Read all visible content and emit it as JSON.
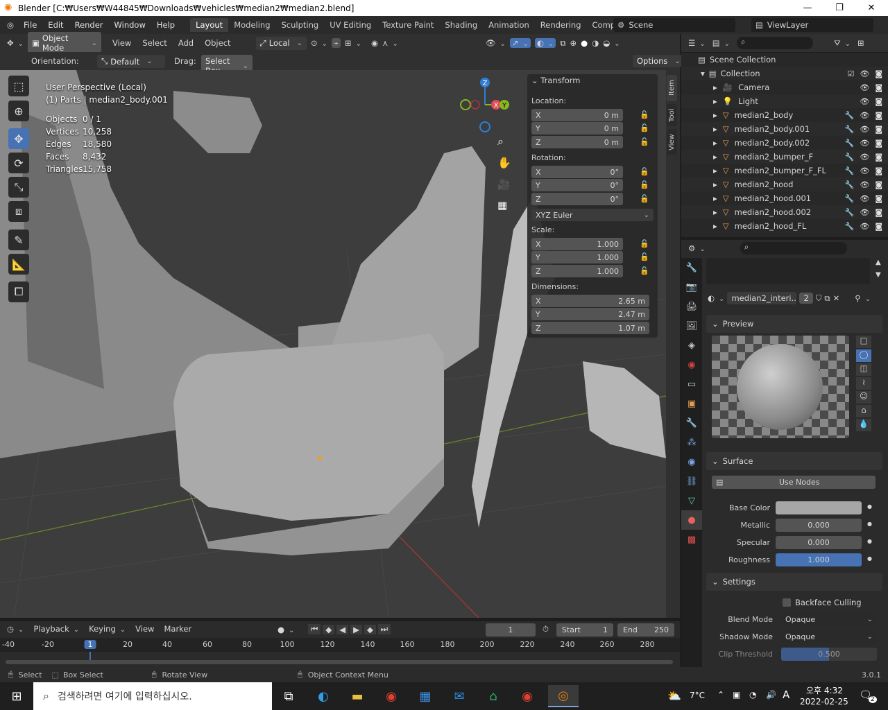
{
  "window": {
    "title": "Blender [C:₩Users₩W44845₩Downloads₩vehicles₩median2₩median2.blend]",
    "minimize": "—",
    "maximize": "❐",
    "close": "✕"
  },
  "menu": [
    "File",
    "Edit",
    "Render",
    "Window",
    "Help"
  ],
  "workspaces": [
    "Layout",
    "Modeling",
    "Sculpting",
    "UV Editing",
    "Texture Paint",
    "Shading",
    "Animation",
    "Rendering",
    "Compositing"
  ],
  "active_workspace": "Layout",
  "scene": {
    "label": "Scene",
    "view_layer": "ViewLayer"
  },
  "vp_header": {
    "mode": "Object Mode",
    "view": "View",
    "select": "Select",
    "add": "Add",
    "object": "Object",
    "transform_space": "Local"
  },
  "tool_header": {
    "orientation_label": "Orientation:",
    "orientation": "Default",
    "drag_label": "Drag:",
    "drag": "Select Box",
    "options": "Options"
  },
  "viewport_info": {
    "line1": "User Perspective (Local)",
    "line2": "(1) Parts | median2_body.001",
    "stats": [
      {
        "k": "Objects",
        "v": "0 / 1"
      },
      {
        "k": "Vertices",
        "v": "10,258"
      },
      {
        "k": "Edges",
        "v": "18,580"
      },
      {
        "k": "Faces",
        "v": "8,432"
      },
      {
        "k": "Triangles",
        "v": "15,758"
      }
    ]
  },
  "gizmo": {
    "z": "Z",
    "x": "X",
    "y": "Y"
  },
  "transform": {
    "title": "Transform",
    "location_label": "Location:",
    "location": [
      {
        "axis": "X",
        "val": "0 m"
      },
      {
        "axis": "Y",
        "val": "0 m"
      },
      {
        "axis": "Z",
        "val": "0 m"
      }
    ],
    "rotation_label": "Rotation:",
    "rotation": [
      {
        "axis": "X",
        "val": "0°"
      },
      {
        "axis": "Y",
        "val": "0°"
      },
      {
        "axis": "Z",
        "val": "0°"
      }
    ],
    "rotation_mode": "XYZ Euler",
    "scale_label": "Scale:",
    "scale": [
      {
        "axis": "X",
        "val": "1.000"
      },
      {
        "axis": "Y",
        "val": "1.000"
      },
      {
        "axis": "Z",
        "val": "1.000"
      }
    ],
    "dimensions_label": "Dimensions:",
    "dimensions": [
      {
        "axis": "X",
        "val": "2.65 m"
      },
      {
        "axis": "Y",
        "val": "2.47 m"
      },
      {
        "axis": "Z",
        "val": "1.07 m"
      }
    ]
  },
  "side_tabs": [
    "Item",
    "Tool",
    "View"
  ],
  "outliner": {
    "scene_collection": "Scene Collection",
    "collection": "Collection",
    "items": [
      "Camera",
      "Light",
      "median2_body",
      "median2_body.001",
      "median2_body.002",
      "median2_bumper_F",
      "median2_bumper_F_FL",
      "median2_hood",
      "median2_hood.001",
      "median2_hood.002",
      "median2_hood_FL"
    ]
  },
  "material": {
    "name": "median2_interi...",
    "users": "2",
    "preview": "Preview",
    "surface": "Surface",
    "use_nodes": "Use Nodes",
    "base_color_label": "Base Color",
    "metallic_label": "Metallic",
    "metallic": "0.000",
    "specular_label": "Specular",
    "specular": "0.000",
    "roughness_label": "Roughness",
    "roughness": "1.000",
    "settings": "Settings",
    "backface": "Backface Culling",
    "blend_label": "Blend Mode",
    "blend": "Opaque",
    "shadow_label": "Shadow Mode",
    "shadow": "Opaque",
    "clip_label": "Clip Threshold",
    "clip": "0.500"
  },
  "timeline": {
    "playback": "Playback",
    "keying": "Keying",
    "view": "View",
    "marker": "Marker",
    "current": "1",
    "start_label": "Start",
    "start": "1",
    "end_label": "End",
    "end": "250",
    "ticks": [
      "-40",
      "-20",
      "1",
      "20",
      "40",
      "60",
      "80",
      "100",
      "120",
      "140",
      "160",
      "180",
      "200",
      "220",
      "240",
      "260",
      "280"
    ]
  },
  "status": {
    "select": "Select",
    "box_select": "Box Select",
    "rotate": "Rotate View",
    "context": "Object Context Menu",
    "version": "3.0.1"
  },
  "taskbar": {
    "search": "검색하려면 여기에 입력하십시오.",
    "temp": "7°C",
    "ime": "A",
    "time": "오후 4:32",
    "date": "2022-02-25",
    "notif": "2"
  },
  "colors": {
    "accent": "#4772b3",
    "x_axis": "#e14b57",
    "y_axis": "#89b81d",
    "z_axis": "#2f7ed8"
  }
}
